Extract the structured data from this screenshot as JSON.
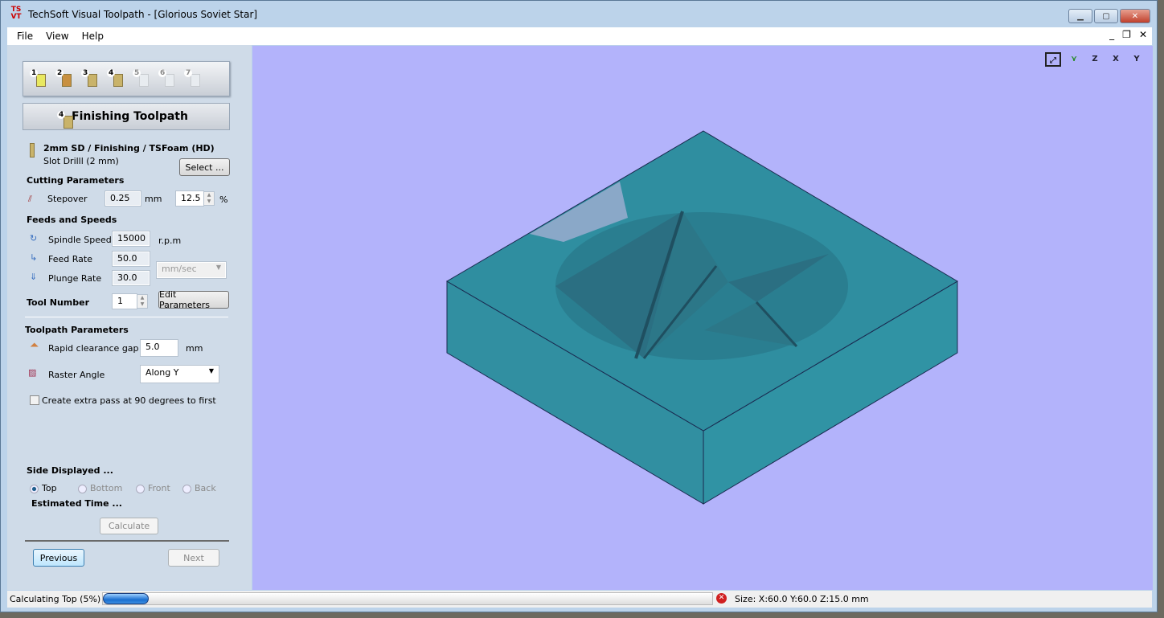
{
  "window": {
    "title": "TechSoft Visual Toolpath - [Glorious Soviet Star]",
    "logo": "TS VT",
    "minimize": "minimize-icon",
    "maximize": "maximize-icon",
    "close": "close-icon"
  },
  "menu": [
    "File",
    "View",
    "Help"
  ],
  "steps": [
    "1",
    "2",
    "3",
    "4",
    "5",
    "6",
    "7"
  ],
  "header": {
    "step": "4",
    "title": "Finishing Toolpath"
  },
  "tool": {
    "name": "2mm SD / Finishing / TSFoam (HD)",
    "desc": "Slot Drilll (2 mm)",
    "select": "Select ..."
  },
  "cutting": {
    "title": "Cutting Parameters",
    "stepover_label": "Stepover",
    "stepover_mm": "0.25",
    "mm": "mm",
    "stepover_pct": "12.5",
    "pct": "%"
  },
  "feeds": {
    "title": "Feeds and Speeds",
    "spindle_label": "Spindle Speed",
    "spindle": "15000",
    "rpm": "r.p.m",
    "feed_label": "Feed Rate",
    "feed": "50.0",
    "plunge_label": "Plunge Rate",
    "plunge": "30.0",
    "units": "mm/sec",
    "tool_number_label": "Tool Number",
    "tool_number": "1",
    "edit": "Edit Parameters"
  },
  "toolpath": {
    "title": "Toolpath Parameters",
    "rapid_label": "Rapid clearance gap",
    "rapid": "5.0",
    "mm": "mm",
    "raster_label": "Raster Angle",
    "raster": "Along Y",
    "extra_pass": "Create extra pass at 90 degrees to first",
    "extra_pass_checked": false
  },
  "side": {
    "title": "Side Displayed ...",
    "options": [
      "Top",
      "Bottom",
      "Front",
      "Back"
    ],
    "selected": "Top"
  },
  "estimate": {
    "title": "Estimated Time ...",
    "calculate": "Calculate"
  },
  "nav": {
    "previous": "Previous",
    "next": "Next"
  },
  "view_icons": [
    "zoom-fit-icon",
    "iso-view-icon",
    "view-z-icon",
    "view-x-icon",
    "view-y-icon"
  ],
  "view_labels": {
    "z": "Z",
    "x": "X",
    "y": "Y"
  },
  "status": {
    "text": "Calculating Top (5%)",
    "progress_percent": 5,
    "size": "Size: X:60.0 Y:60.0 Z:15.0 mm"
  },
  "colors": {
    "viewport": "#b3b3fb",
    "model": "#2f8ea0",
    "panel": "#cfdbe8"
  }
}
